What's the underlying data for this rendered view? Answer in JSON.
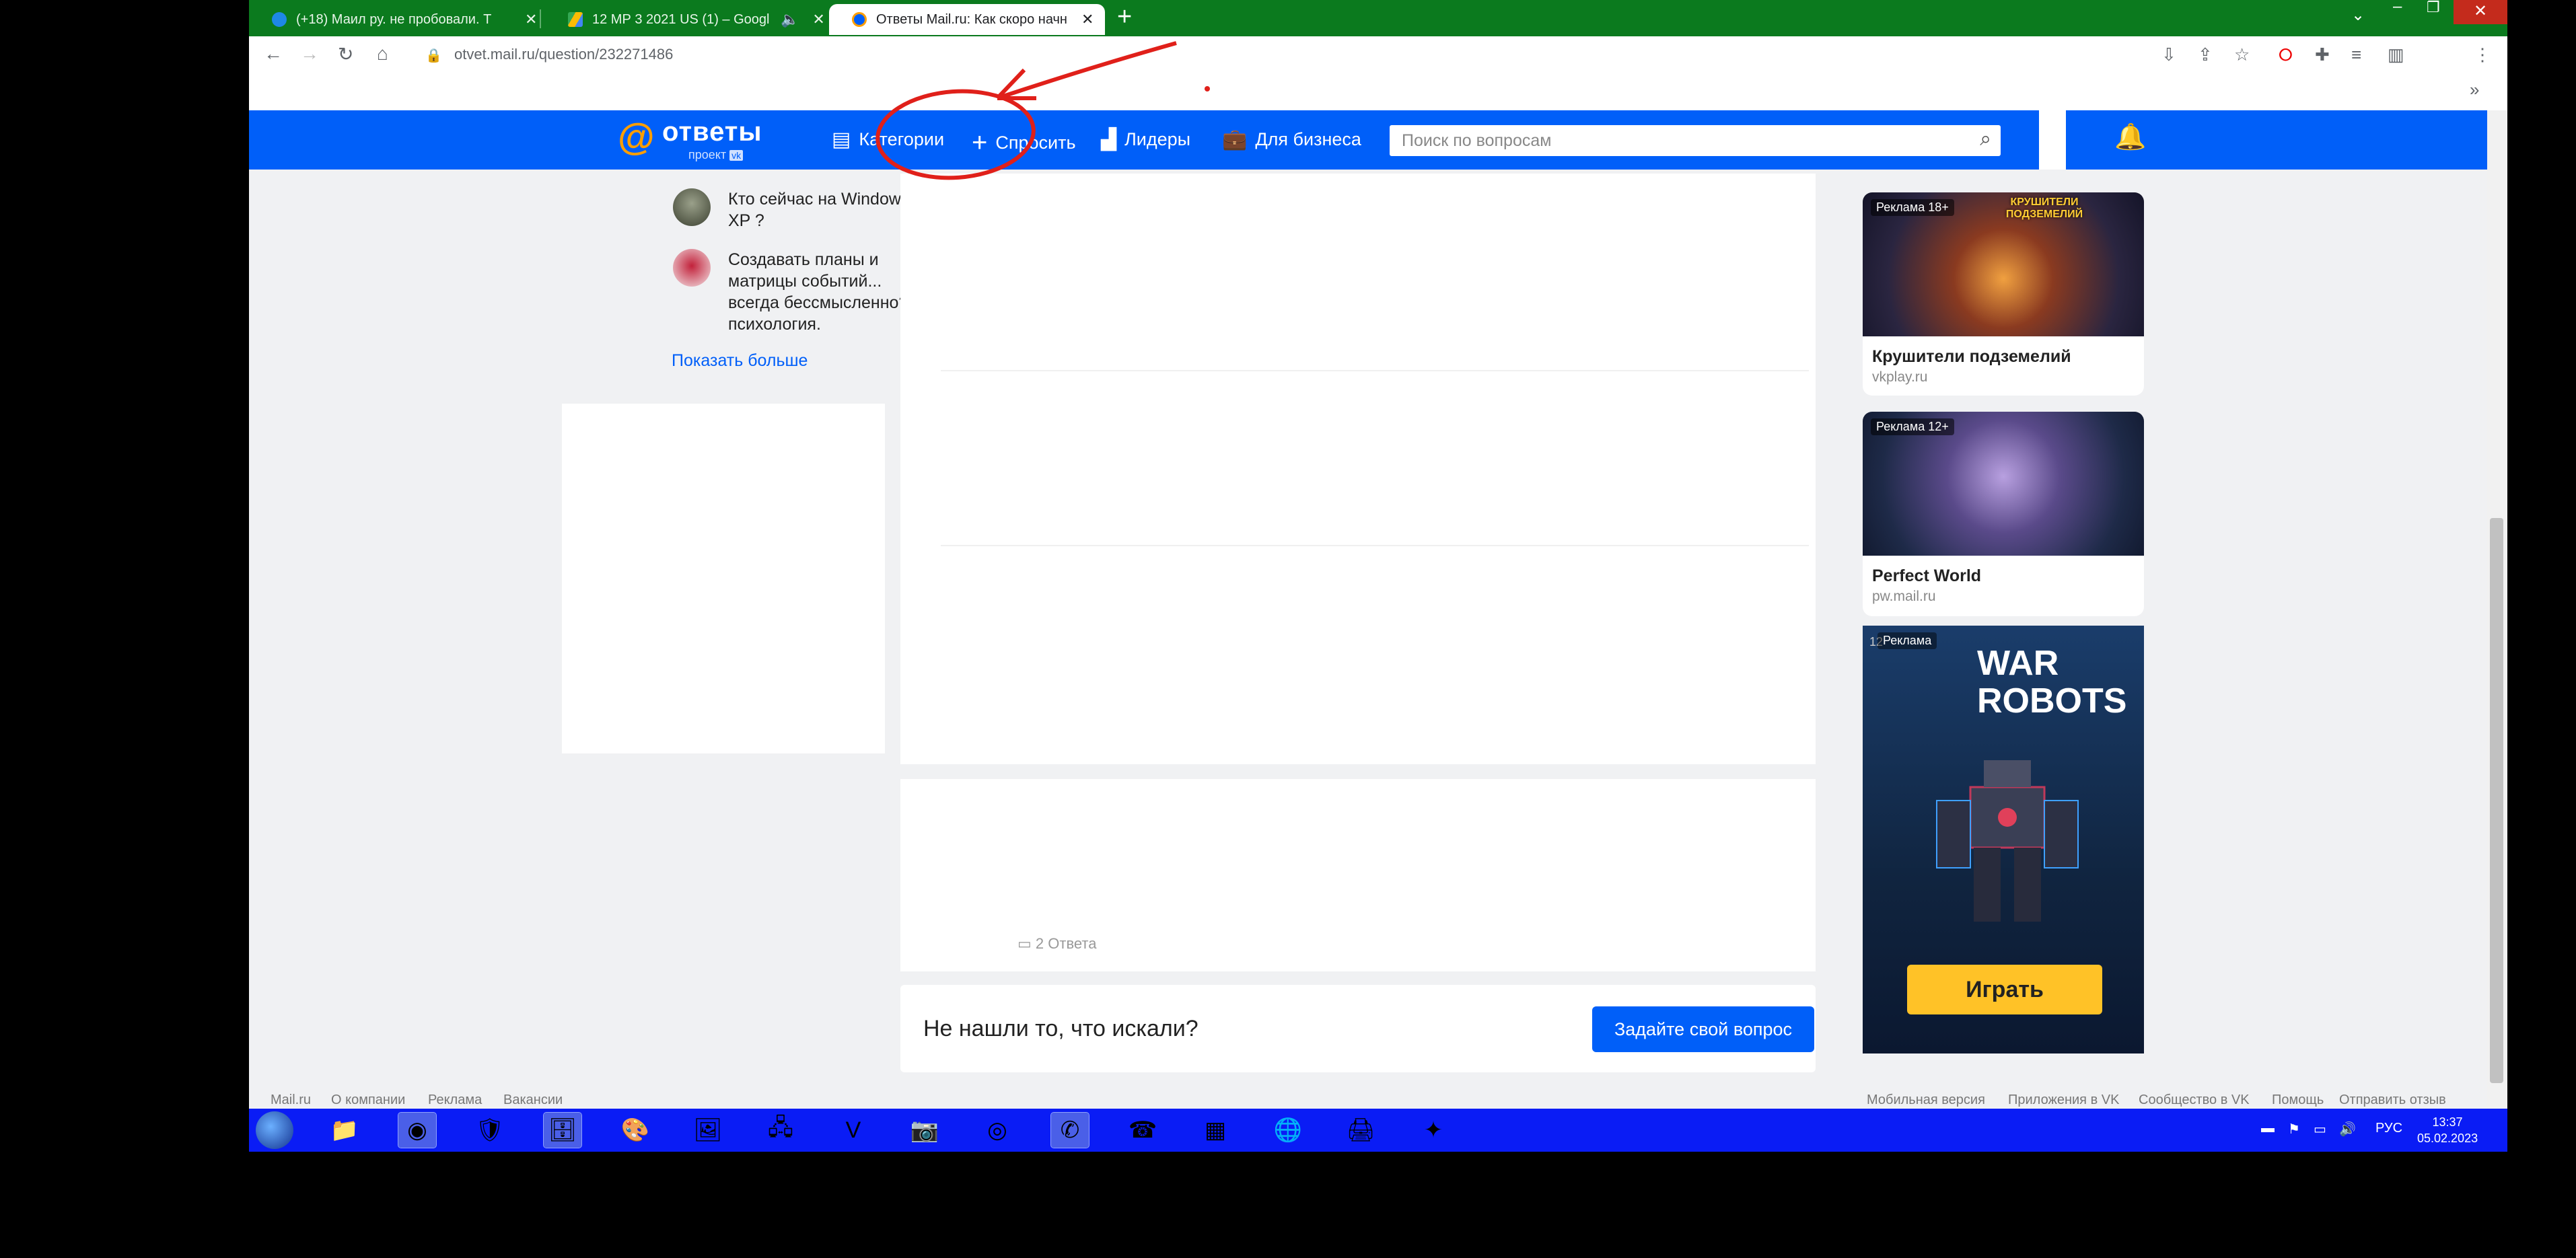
{
  "browser": {
    "tabs": [
      {
        "title": "(+18) Маил ру. не пробовали. Т",
        "active": false,
        "icon": "blue-dot-icon"
      },
      {
        "title": "12 МР 3 2021 US (1) – Googl",
        "active": false,
        "icon": "drive-icon"
      },
      {
        "title": "Ответы Mail.ru: Как скоро начн",
        "active": true,
        "icon": "otvety-icon"
      }
    ],
    "url": "otvet.mail.ru/question/232271486",
    "bookmarks_overflow": "»"
  },
  "site": {
    "logo_text": "ответы",
    "logo_sub": "проект",
    "nav": {
      "categories": "Категории",
      "ask": "Спросить",
      "leaders": "Лидеры",
      "business": "Для бизнеса"
    },
    "search": {
      "placeholder": "Поиск по вопросам"
    }
  },
  "sidebar": {
    "questions": [
      {
        "text": "Кто сейчас на Windows XP ?"
      },
      {
        "text": "Создавать планы и матрицы событий... всегда бессмысленно? психология."
      }
    ],
    "show_more": "Показать больше"
  },
  "main": {
    "answers_count": "2 Ответа",
    "not_found": {
      "text": "Не нашли то, что искали?",
      "button": "Задайте свой вопрос"
    }
  },
  "ads": [
    {
      "badge": "Реклама 18+",
      "title": "Крушители подземелий",
      "domain": "vkplay.ru",
      "art": "КРУШИТЕЛИ ПОДЗЕМЕЛИЙ"
    },
    {
      "badge": "Реклама 12+",
      "title": "Perfect World",
      "domain": "pw.mail.ru"
    },
    {
      "badge": "Реклама",
      "age": "12",
      "game_title": "WAR ROBOTS",
      "button": "Играть"
    }
  ],
  "footer": {
    "left": [
      "Mail.ru",
      "О компании",
      "Реклама",
      "Вакансии"
    ],
    "right": [
      "Мобильная версия",
      "Приложения в VK",
      "Сообщество в VK",
      "Помощь",
      "Отправить отзыв"
    ]
  },
  "taskbar": {
    "lang": "РУС",
    "time": "13:37",
    "date": "05.02.2023"
  },
  "colors": {
    "brand_blue": "#005ff9",
    "logo_orange": "#ff9e00",
    "taskbar_blue": "#0a1cf5",
    "tabstrip_green": "#0b7a1e",
    "annotation_red": "#e0201a"
  }
}
